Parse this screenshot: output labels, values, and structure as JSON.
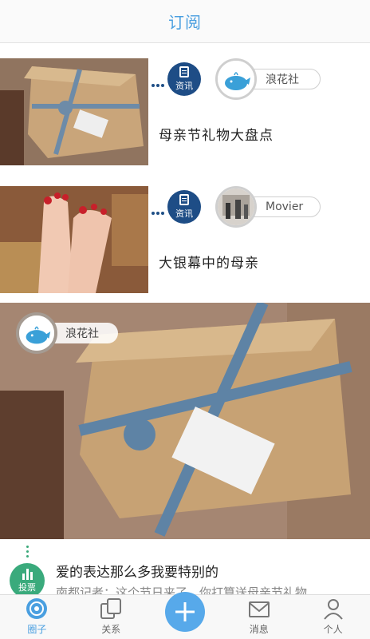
{
  "header": {
    "title": "订阅"
  },
  "feed": [
    {
      "category": "资讯",
      "source": "浪花社",
      "title": "母亲节礼物大盘点"
    },
    {
      "category": "资讯",
      "source": "Movier",
      "title": "大银幕中的母亲"
    }
  ],
  "card": {
    "source": "浪花社",
    "badge": "投票",
    "title": "爱的表达那么多我要特别的",
    "excerpt": "南都记者：这个节日来了，你打算送母亲节礼物……"
  },
  "tabs": [
    {
      "label": "圈子",
      "icon": "circle-icon",
      "active": true
    },
    {
      "label": "关系",
      "icon": "relations-icon"
    },
    {
      "label": "",
      "icon": "plus-icon"
    },
    {
      "label": "消息",
      "icon": "mail-icon"
    },
    {
      "label": "个人",
      "icon": "person-icon"
    }
  ],
  "colors": {
    "accent": "#4a9fe0",
    "category_badge": "#1e4d86",
    "vote_badge": "#3aaa7c"
  }
}
